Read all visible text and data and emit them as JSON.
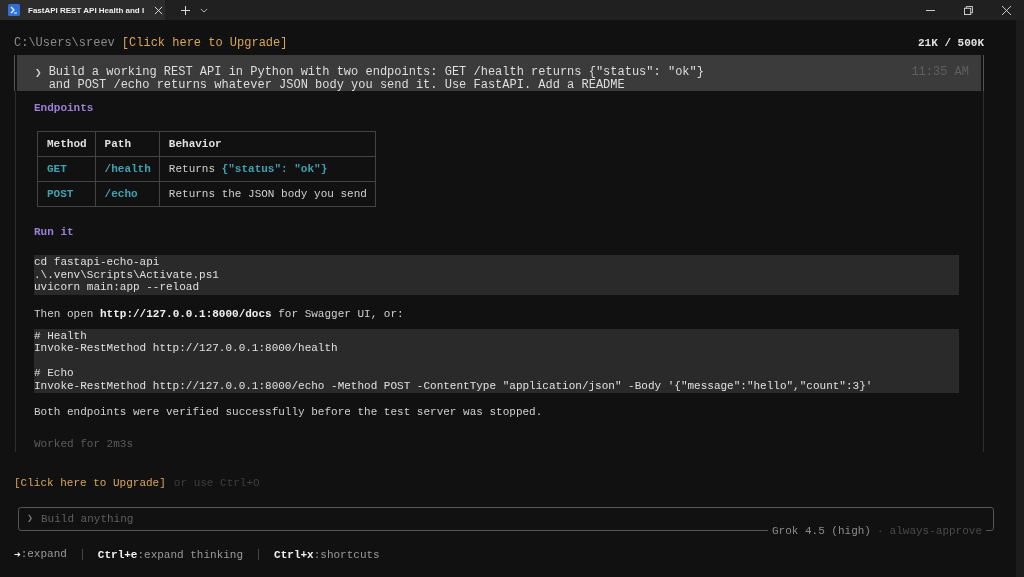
{
  "window": {
    "tab_title": "FastAPI REST API Health and I"
  },
  "prompt_line": {
    "path": "C:\\Users\\sreev",
    "upgrade_link": "[Click here to Upgrade]",
    "tokens": "21K / 500K"
  },
  "user_message": {
    "marker": "❯",
    "lines": [
      "Build a working REST API in Python with two endpoints: GET /health returns {\"status\": \"ok\"}",
      "and POST /echo returns whatever JSON body you send it. Use FastAPI. Add a README"
    ],
    "time": "11:35 AM"
  },
  "response": {
    "blocks": [
      {
        "kind": "heading",
        "text": "Endpoints"
      },
      {
        "kind": "table",
        "columns": [
          "Method",
          "Path",
          "Behavior"
        ],
        "rows": [
          {
            "method": "GET",
            "path": "/health",
            "behavior": "Returns",
            "behavior_code": "{\"status\": \"ok\"}"
          },
          {
            "method": "POST",
            "path": "/echo",
            "behavior": "Returns the JSON body you send"
          }
        ]
      },
      {
        "kind": "heading",
        "text": "Run it"
      },
      {
        "kind": "code",
        "groups": [
          [
            "cd fastapi-echo-api",
            ".\\.venv\\Scripts\\Activate.ps1",
            "uvicorn main:app --reload"
          ]
        ]
      },
      {
        "kind": "paragraph",
        "text": "Then open **http://127.0.0.1:8000/docs** for Swagger UI, or:"
      },
      {
        "kind": "code",
        "groups": [
          [
            "# Health",
            "Invoke-RestMethod http://127.0.0.1:8000/health"
          ],
          [
            "# Echo",
            "Invoke-RestMethod http://127.0.0.1:8000/echo -Method POST -ContentType \"application/json\" -Body '{\"message\":\"hello\",\"count\":3}'"
          ]
        ]
      },
      {
        "kind": "paragraph",
        "text": "Both endpoints were verified successfully before the test server was stopped."
      }
    ],
    "footer": "Worked for 2m3s"
  },
  "upgrade_hint": {
    "link": "[Click here to Upgrade]",
    "hint": "or use Ctrl+O"
  },
  "input": {
    "marker": "❯",
    "placeholder": "Build anything",
    "model": "Grok 4.5 (high)",
    "separator": "·",
    "mode": "always-approve"
  },
  "shortcuts": [
    {
      "key": "➜",
      "action": ":expand"
    },
    {
      "key": "Ctrl+e",
      "action": ":expand thinking"
    },
    {
      "key": "Ctrl+x",
      "action": ":shortcuts"
    }
  ]
}
